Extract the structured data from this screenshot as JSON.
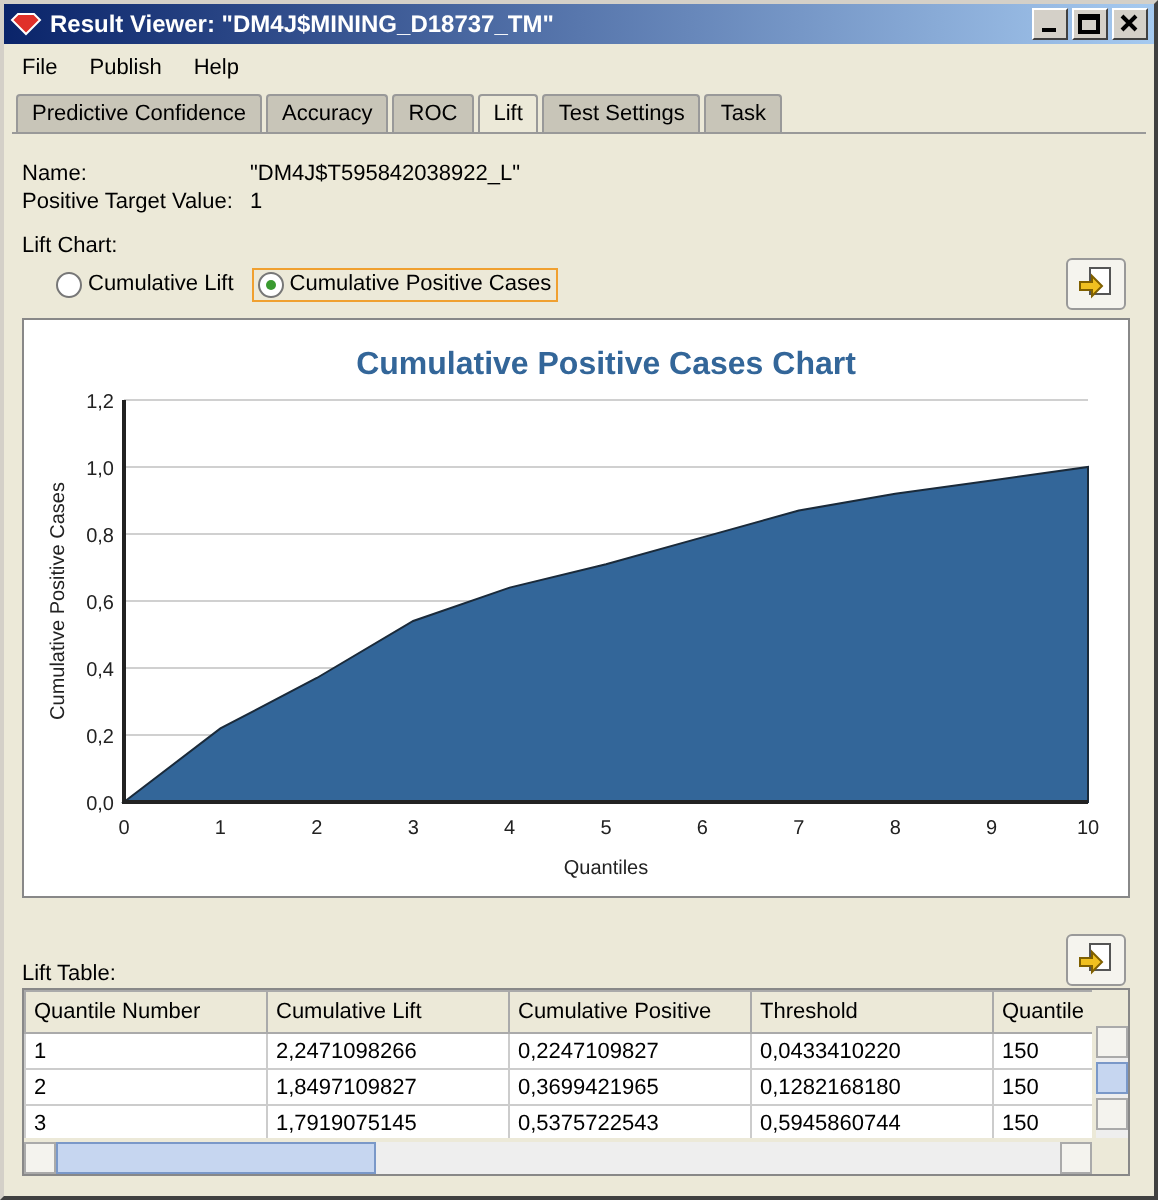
{
  "window": {
    "title": "Result Viewer: \"DM4J$MINING_D18737_TM\""
  },
  "menu": [
    "File",
    "Publish",
    "Help"
  ],
  "tabs": [
    {
      "label": "Predictive Confidence",
      "selected": false
    },
    {
      "label": "Accuracy",
      "selected": false
    },
    {
      "label": "ROC",
      "selected": false
    },
    {
      "label": "Lift",
      "selected": true
    },
    {
      "label": "Test Settings",
      "selected": false
    },
    {
      "label": "Task",
      "selected": false
    }
  ],
  "info": [
    {
      "label": "Name:",
      "value": "\"DM4J$T595842038922_L\""
    },
    {
      "label": "Positive Target Value:",
      "value": "1"
    }
  ],
  "lift_chart": {
    "label": "Lift Chart:",
    "options": [
      {
        "label": "Cumulative Lift",
        "selected": false
      },
      {
        "label": "Cumulative Positive Cases",
        "selected": true
      }
    ],
    "chart_data": {
      "type": "area",
      "title": "Cumulative Positive Cases Chart",
      "xlabel": "Quantiles",
      "ylabel": "Cumulative Positive Cases",
      "x": [
        0,
        1,
        2,
        3,
        4,
        5,
        6,
        7,
        8,
        9,
        10
      ],
      "series": [
        {
          "color": "#336699",
          "values": [
            0,
            0.22,
            0.37,
            0.54,
            0.64,
            0.71,
            0.79,
            0.87,
            0.92,
            0.96,
            1.0
          ]
        }
      ],
      "grid": true,
      "xlim": [
        0,
        10
      ],
      "ylim": [
        0,
        1.2
      ],
      "xticks": [
        0,
        1,
        2,
        3,
        4,
        5,
        6,
        7,
        8,
        9,
        10
      ],
      "yticks": [
        {
          "value": 0,
          "label": "0,0"
        },
        {
          "value": 0.2,
          "label": "0,2"
        },
        {
          "value": 0.4,
          "label": "0,4"
        },
        {
          "value": 0.6,
          "label": "0,6"
        },
        {
          "value": 0.8,
          "label": "0,8"
        },
        {
          "value": 1.0,
          "label": "1,0"
        },
        {
          "value": 1.2,
          "label": "1,2"
        }
      ]
    }
  },
  "lift_table": {
    "label": "Lift Table:",
    "columns": [
      "Quantile Number",
      "Cumulative Lift",
      "Cumulative Positive",
      "Threshold",
      "Quantile"
    ],
    "rows": [
      [
        "1",
        "2,2471098266",
        "0,2247109827",
        "0,0433410220",
        "150"
      ],
      [
        "2",
        "1,8497109827",
        "0,3699421965",
        "0,1282168180",
        "150"
      ],
      [
        "3",
        "1,7919075145",
        "0,5375722543",
        "0,5945860744",
        "150"
      ]
    ]
  }
}
